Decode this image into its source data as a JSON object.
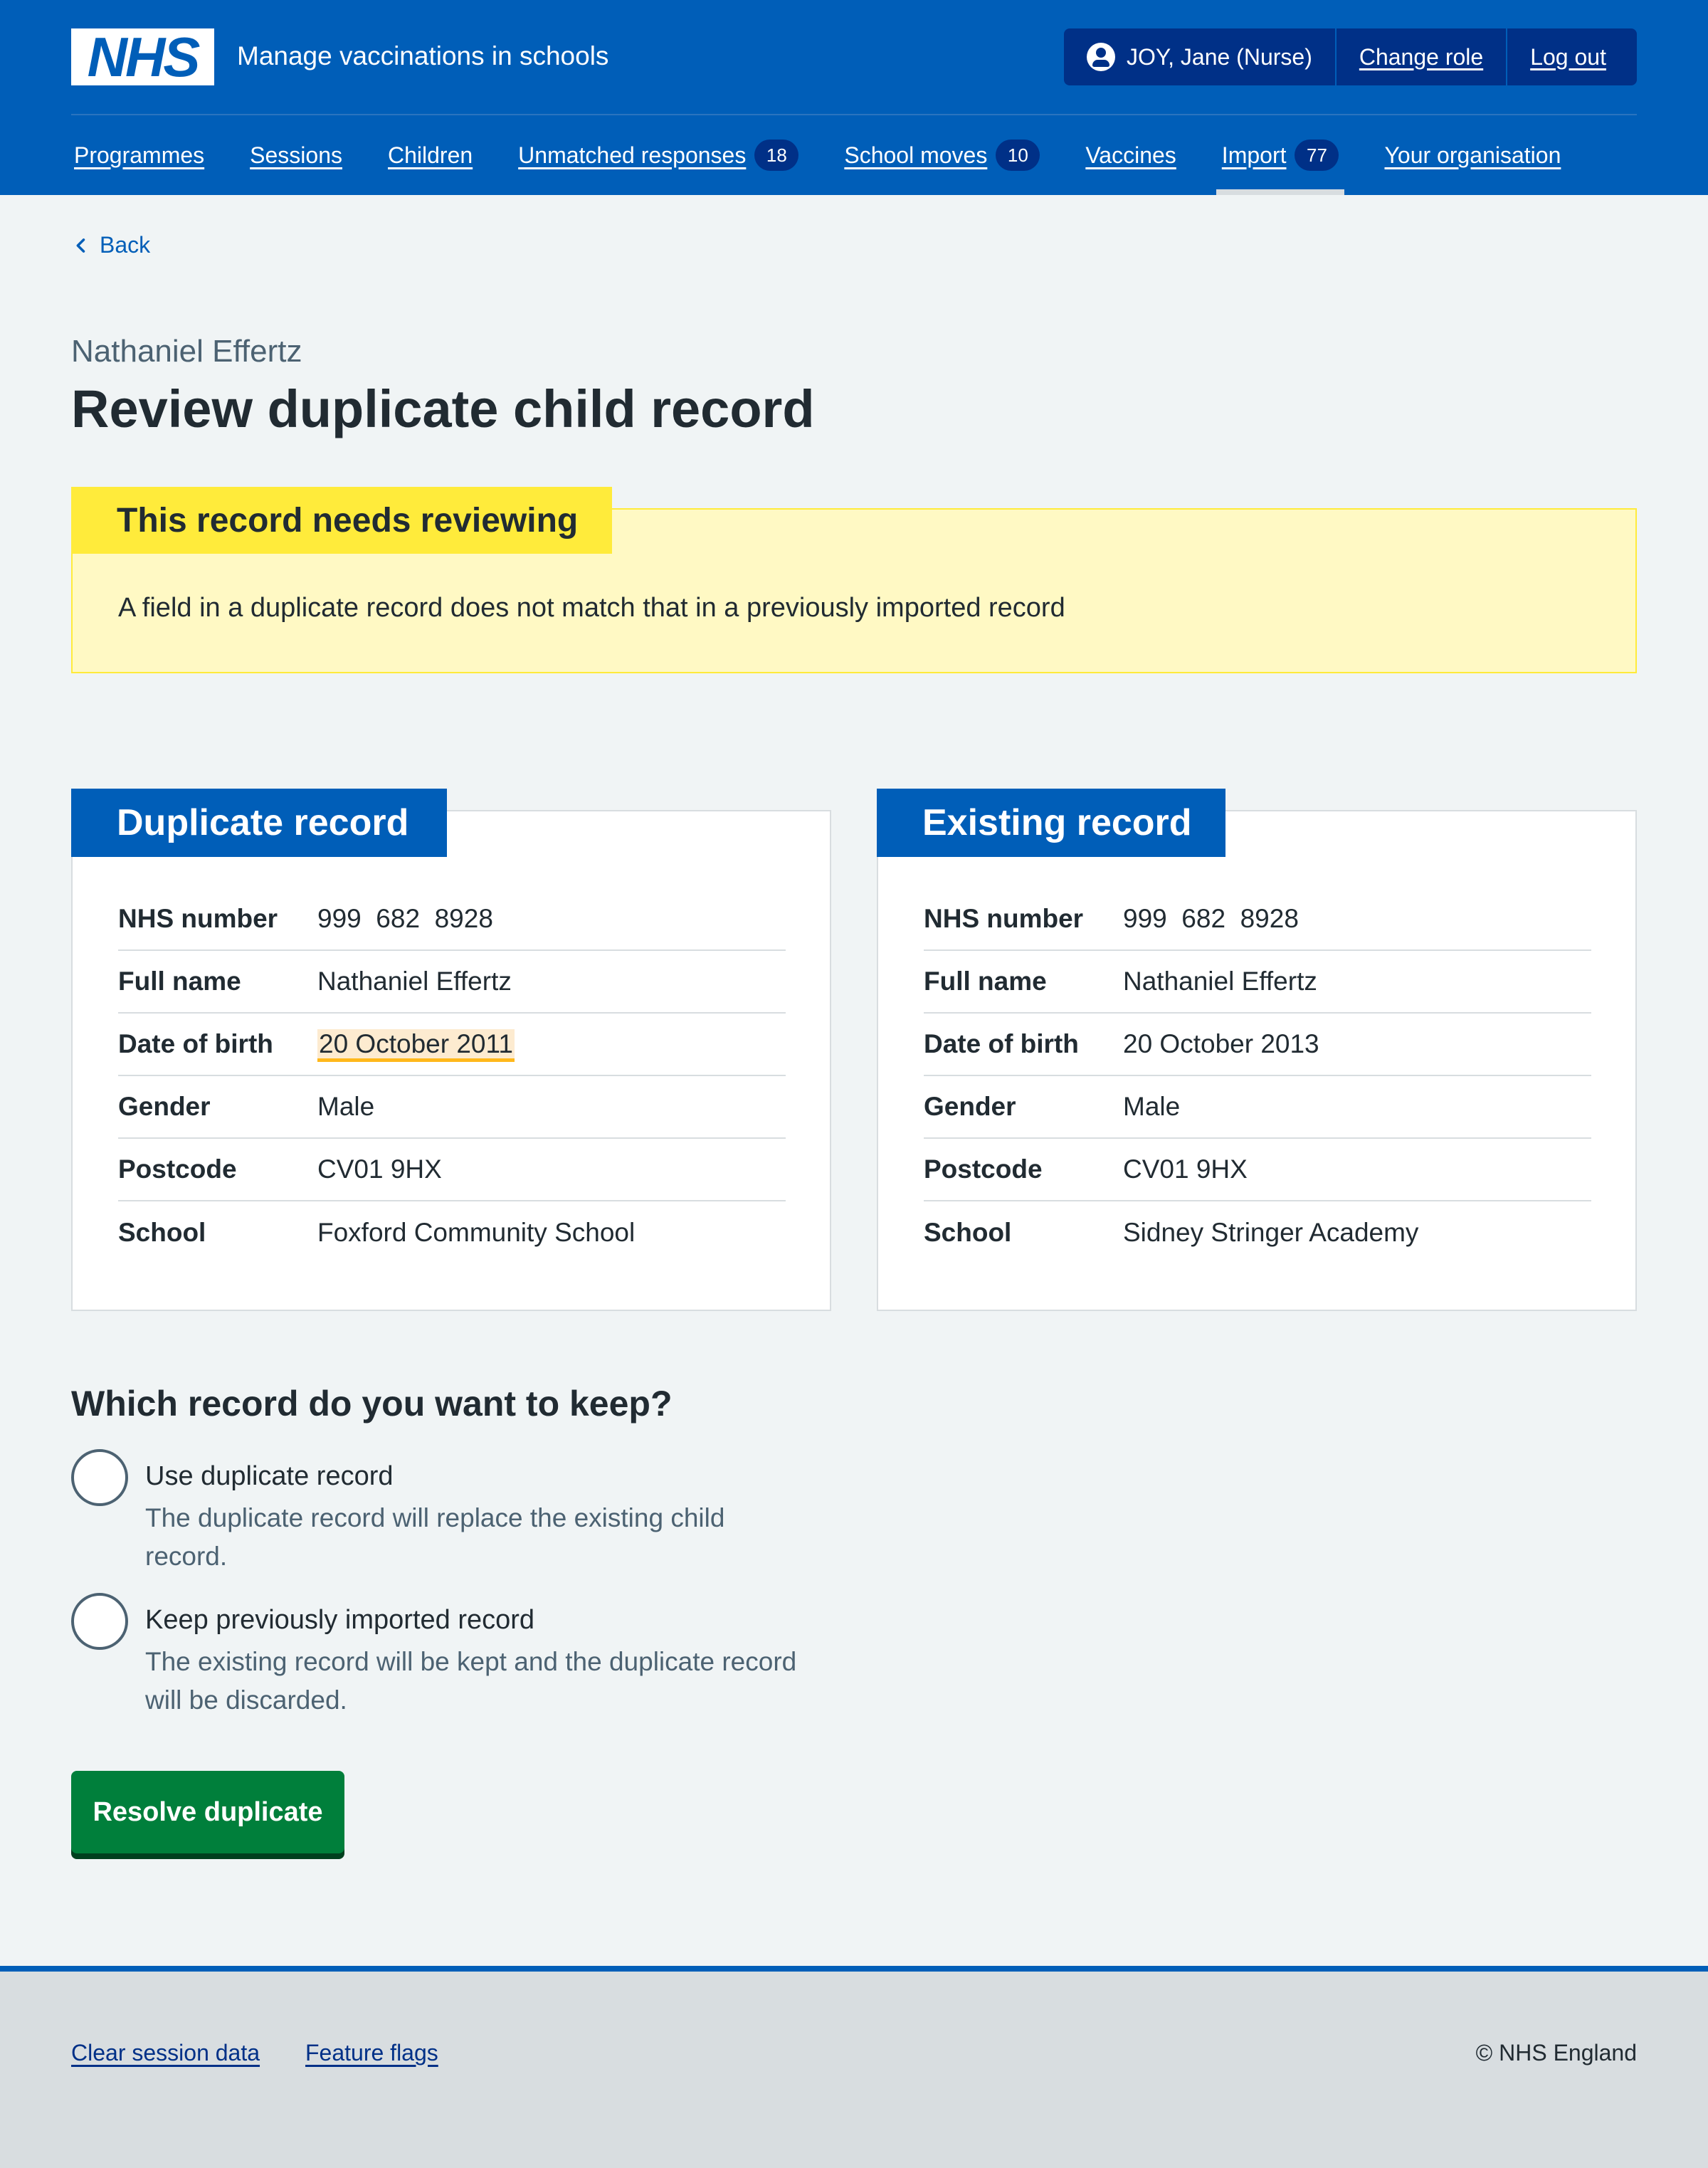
{
  "header": {
    "logo_text": "NHS",
    "service_name": "Manage vaccinations in schools",
    "account": {
      "user": "JOY, Jane (Nurse)",
      "change_role": "Change role",
      "log_out": "Log out"
    },
    "nav": [
      {
        "label": "Programmes"
      },
      {
        "label": "Sessions"
      },
      {
        "label": "Children"
      },
      {
        "label": "Unmatched responses",
        "count": "18"
      },
      {
        "label": "School moves",
        "count": "10"
      },
      {
        "label": "Vaccines"
      },
      {
        "label": "Import",
        "count": "77",
        "active": true
      },
      {
        "label": "Your organisation"
      }
    ]
  },
  "back_link": "Back",
  "caption": "Nathaniel Effertz",
  "title": "Review duplicate child record",
  "warning": {
    "heading": "This record needs reviewing",
    "text": "A field in a duplicate record does not match that in a previously imported record"
  },
  "duplicate_record": {
    "heading": "Duplicate record",
    "rows": [
      {
        "key": "NHS number",
        "value": "999  682  8928"
      },
      {
        "key": "Full name",
        "value": "Nathaniel Effertz"
      },
      {
        "key": "Date of birth",
        "value": "20 October 2011",
        "highlight": true
      },
      {
        "key": "Gender",
        "value": "Male"
      },
      {
        "key": "Postcode",
        "value": "CV01 9HX"
      },
      {
        "key": "School",
        "value": "Foxford Community School"
      }
    ]
  },
  "existing_record": {
    "heading": "Existing record",
    "rows": [
      {
        "key": "NHS number",
        "value": "999  682  8928"
      },
      {
        "key": "Full name",
        "value": "Nathaniel Effertz"
      },
      {
        "key": "Date of birth",
        "value": "20 October 2013"
      },
      {
        "key": "Gender",
        "value": "Male"
      },
      {
        "key": "Postcode",
        "value": "CV01 9HX"
      },
      {
        "key": "School",
        "value": "Sidney Stringer Academy"
      }
    ]
  },
  "question": "Which record do you want to keep?",
  "options": [
    {
      "label": "Use duplicate record",
      "hint": "The duplicate record will replace the existing child record."
    },
    {
      "label": "Keep previously imported record",
      "hint": "The existing record will be kept and the duplicate record will be discarded."
    }
  ],
  "submit_label": "Resolve duplicate",
  "footer": {
    "links": [
      "Clear session data",
      "Feature flags"
    ],
    "copyright": "© NHS England"
  },
  "colors": {
    "brand_blue": "#005eb8",
    "dark_blue": "#003087",
    "warning_yellow": "#ffeb3b",
    "highlight_amber": "#ffb81c",
    "button_green": "#007f3b"
  }
}
